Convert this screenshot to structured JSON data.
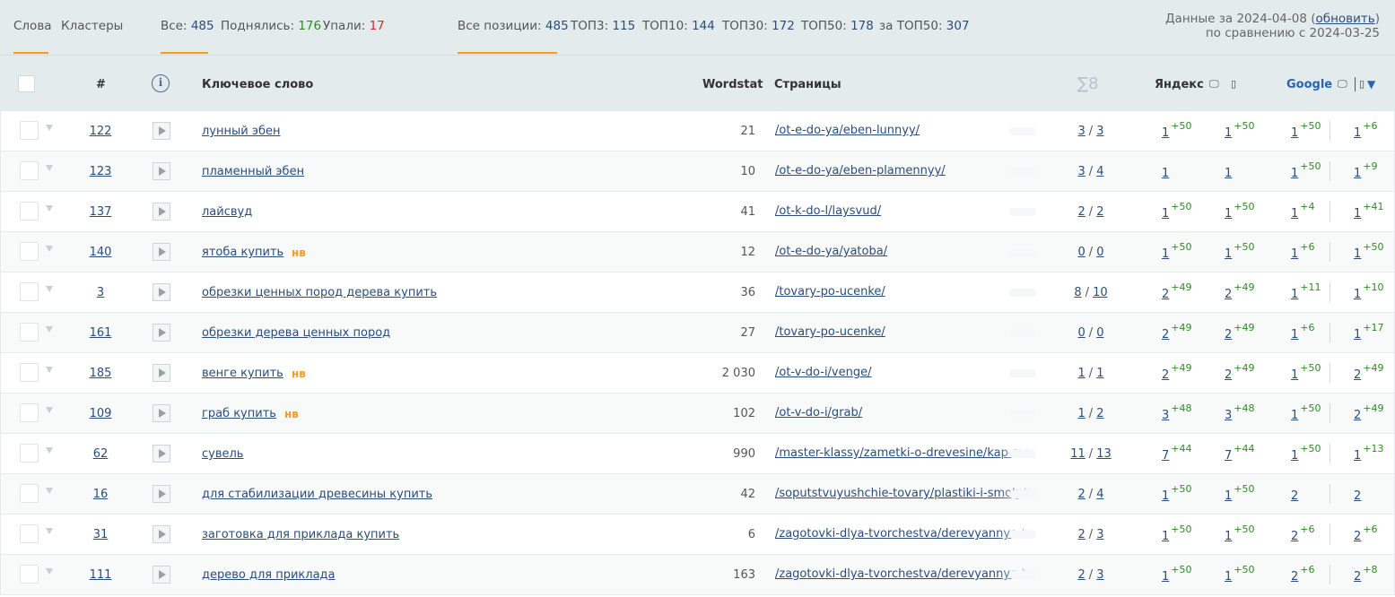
{
  "topbar": {
    "tabs": [
      {
        "label": "Слова"
      },
      {
        "label": "Кластеры"
      }
    ],
    "counts": {
      "all_label": "Все:",
      "all_value": "485",
      "up_label": "Поднялись:",
      "up_value": "176",
      "down_label": "Упали:",
      "down_value": "17"
    },
    "positions": {
      "all_label": "Все позиции:",
      "all_value": "485",
      "top3_label": "ТОП3:",
      "top3_value": "115",
      "top10_label": "ТОП10:",
      "top10_value": "144",
      "top30_label": "ТОП30:",
      "top30_value": "172",
      "top50_label": "ТОП50:",
      "top50_value": "178",
      "beyond_label": "за ТОП50:",
      "beyond_value": "307"
    },
    "date_line1_prefix": "Данные за 2024-04-08 (",
    "refresh_label": "обновить",
    "date_line1_suffix": ")",
    "date_line2": "по сравнению с 2024-03-25"
  },
  "table_header": {
    "num": "#",
    "info_icon": "i",
    "keyword": "Ключевое слово",
    "wordstat": "Wordstat",
    "pages": "Страницы",
    "sigma": "∑8",
    "yandex": "Яндекс",
    "google": "Google",
    "desktop_icon": "🖵",
    "mobile_icon": "▯",
    "sort_icon": "▼"
  },
  "rows": [
    {
      "num": "122",
      "kw": "лунный эбен",
      "badge": "",
      "ws": "21",
      "page": "/ot-e-do-ya/eben-lunnyy/",
      "c1": "3",
      "c2": "3",
      "y1": "1",
      "y1d": "+50",
      "y2": "1",
      "y2d": "+50",
      "g1": "1",
      "g1d": "+50",
      "g2": "1",
      "g2d": "+6"
    },
    {
      "num": "123",
      "kw": "пламенный эбен",
      "badge": "",
      "ws": "10",
      "page": "/ot-e-do-ya/eben-plamennyy/",
      "c1": "3",
      "c2": "4",
      "y1": "1",
      "y1d": "",
      "y2": "1",
      "y2d": "",
      "g1": "1",
      "g1d": "+50",
      "g2": "1",
      "g2d": "+9"
    },
    {
      "num": "137",
      "kw": "лайсвуд",
      "badge": "",
      "ws": "41",
      "page": "/ot-k-do-l/laysvud/",
      "c1": "2",
      "c2": "2",
      "y1": "1",
      "y1d": "+50",
      "y2": "1",
      "y2d": "+50",
      "g1": "1",
      "g1d": "+4",
      "g2": "1",
      "g2d": "+41"
    },
    {
      "num": "140",
      "kw": "ятоба купить",
      "badge": "нв",
      "ws": "12",
      "page": "/ot-e-do-ya/yatoba/",
      "c1": "0",
      "c2": "0",
      "y1": "1",
      "y1d": "+50",
      "y2": "1",
      "y2d": "+50",
      "g1": "1",
      "g1d": "+6",
      "g2": "1",
      "g2d": "+50"
    },
    {
      "num": "3",
      "kw": "обрезки ценных пород дерева купить",
      "badge": "",
      "ws": "36",
      "page": "/tovary-po-ucenke/",
      "c1": "8",
      "c2": "10",
      "y1": "2",
      "y1d": "+49",
      "y2": "2",
      "y2d": "+49",
      "g1": "1",
      "g1d": "+11",
      "g2": "1",
      "g2d": "+10"
    },
    {
      "num": "161",
      "kw": "обрезки дерева ценных пород",
      "badge": "",
      "ws": "27",
      "page": "/tovary-po-ucenke/",
      "c1": "0",
      "c2": "0",
      "y1": "2",
      "y1d": "+49",
      "y2": "2",
      "y2d": "+49",
      "g1": "1",
      "g1d": "+6",
      "g2": "1",
      "g2d": "+17"
    },
    {
      "num": "185",
      "kw": "венге купить",
      "badge": "нв",
      "ws": "2 030",
      "page": "/ot-v-do-i/venge/",
      "c1": "1",
      "c2": "1",
      "y1": "2",
      "y1d": "+49",
      "y2": "2",
      "y2d": "+49",
      "g1": "1",
      "g1d": "+50",
      "g2": "2",
      "g2d": "+49"
    },
    {
      "num": "109",
      "kw": "граб купить",
      "badge": "нв",
      "ws": "102",
      "page": "/ot-v-do-i/grab/",
      "c1": "1",
      "c2": "2",
      "y1": "3",
      "y1d": "+48",
      "y2": "3",
      "y2d": "+48",
      "g1": "1",
      "g1d": "+50",
      "g2": "2",
      "g2d": "+49"
    },
    {
      "num": "62",
      "kw": "сувель",
      "badge": "",
      "ws": "990",
      "page": "/master-klassy/zametki-o-drevesine/kap-suvel-shpon/",
      "c1": "11",
      "c2": "13",
      "y1": "7",
      "y1d": "+44",
      "y2": "7",
      "y2d": "+44",
      "g1": "1",
      "g1d": "+50",
      "g2": "1",
      "g2d": "+13"
    },
    {
      "num": "16",
      "kw": "для стабилизации древесины купить",
      "badge": "",
      "ws": "42",
      "page": "/soputstvuyushchie-tovary/plastiki-i-smoly/sostavy/",
      "c1": "2",
      "c2": "4",
      "y1": "1",
      "y1d": "+50",
      "y2": "1",
      "y2d": "+50",
      "g1": "2",
      "g1d": "",
      "g2": "2",
      "g2d": ""
    },
    {
      "num": "31",
      "kw": "заготовка для приклада купить",
      "badge": "",
      "ws": "6",
      "page": "/zagotovki-dlya-tvorchestva/derevyannye-bruski/zagotovki/",
      "c1": "2",
      "c2": "3",
      "y1": "1",
      "y1d": "+50",
      "y2": "1",
      "y2d": "+50",
      "g1": "2",
      "g1d": "+6",
      "g2": "2",
      "g2d": "+6"
    },
    {
      "num": "111",
      "kw": "дерево для приклада",
      "badge": "",
      "ws": "163",
      "page": "/zagotovki-dlya-tvorchestva/derevyannye-bruski/zagotovki/",
      "c1": "2",
      "c2": "3",
      "y1": "1",
      "y1d": "+50",
      "y2": "1",
      "y2d": "+50",
      "g1": "2",
      "g1d": "+6",
      "g2": "2",
      "g2d": "+8"
    }
  ]
}
